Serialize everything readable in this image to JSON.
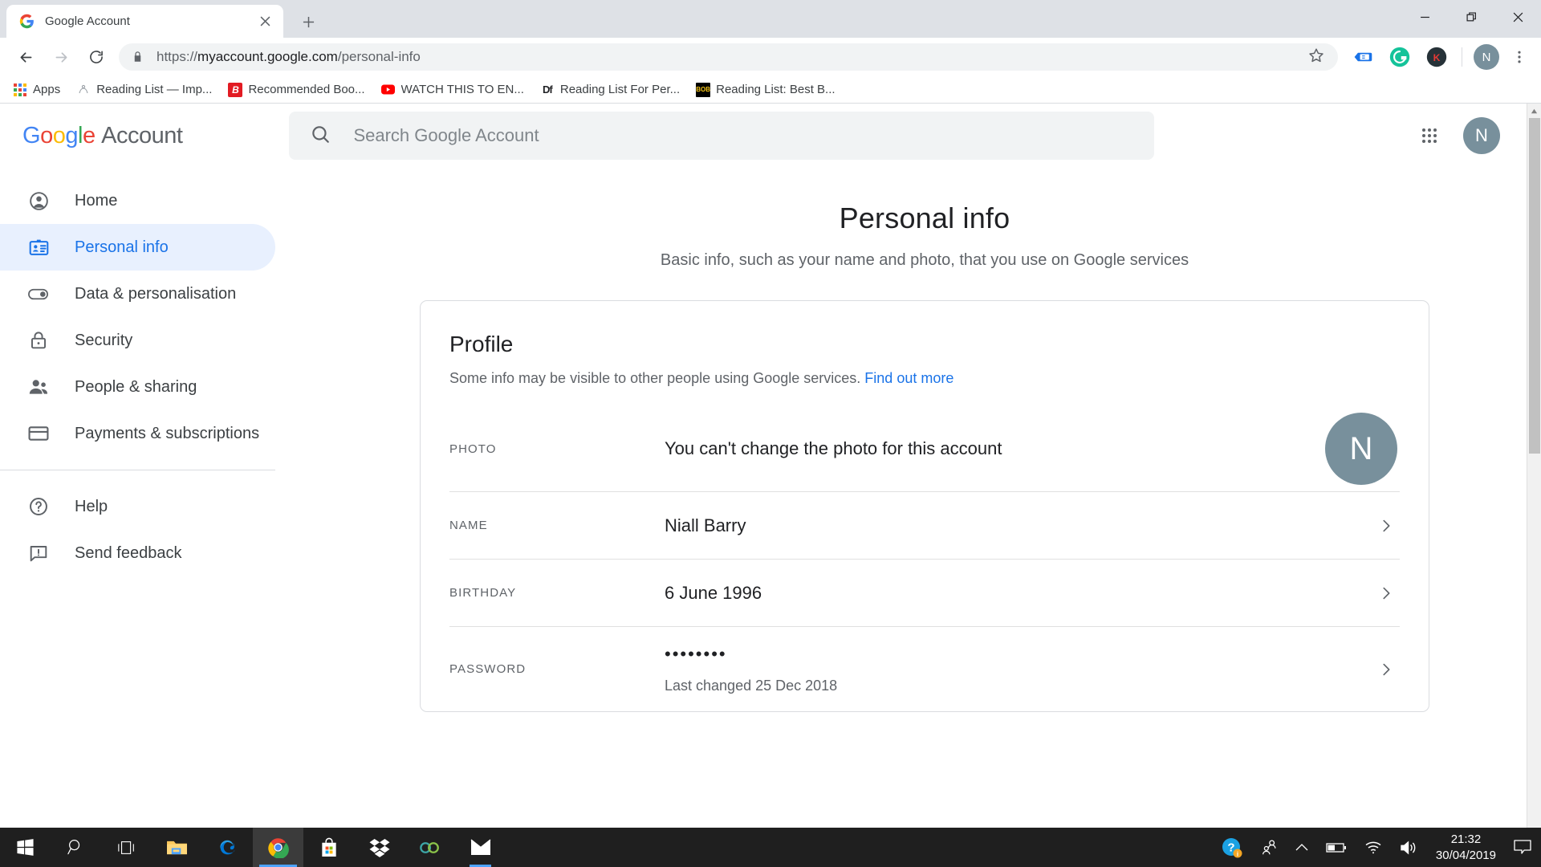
{
  "browser": {
    "tab": {
      "title": "Google Account",
      "favicon": "google-g-icon"
    },
    "new_tab_label": "+",
    "window_controls": {
      "minimize": "minimize-icon",
      "restore": "restore-icon",
      "close": "close-icon"
    },
    "nav": {
      "back": "back-arrow-icon",
      "forward": "forward-arrow-icon",
      "reload": "reload-icon"
    },
    "omnibox": {
      "lock": "lock-icon",
      "scheme": "https://",
      "host": "myaccount.google.com",
      "path": "/personal-info",
      "full_url": "https://myaccount.google.com/personal-info",
      "star": "star-icon"
    },
    "extensions": [
      {
        "name": "pocket-tag-icon",
        "letter": "",
        "bg": "#1a73e8"
      },
      {
        "name": "grammarly-icon",
        "letter": "G",
        "bg": "#15c39a"
      },
      {
        "name": "kami-icon",
        "letter": "K",
        "bg": "#263238"
      }
    ],
    "profile_initial": "N",
    "menu": "kebab-menu-icon",
    "bookmarks": [
      {
        "label": "Apps",
        "icon": "apps-grid-icon"
      },
      {
        "label": "Reading List — Imp...",
        "icon": "generic-site-icon"
      },
      {
        "label": "Recommended Boo...",
        "icon": "blinkist-icon"
      },
      {
        "label": "WATCH THIS TO EN...",
        "icon": "youtube-icon"
      },
      {
        "label": "Reading List For Per...",
        "icon": "df-icon"
      },
      {
        "label": "Reading List: Best B...",
        "icon": "bob-icon"
      }
    ]
  },
  "gaccount": {
    "logo": {
      "g1": "G",
      "o1": "o",
      "o2": "o",
      "g2": "g",
      "l": "l",
      "e": "e",
      "product": "Account"
    },
    "search_placeholder": "Search Google Account",
    "apps_grid": "apps-grid-icon",
    "avatar_initial": "N"
  },
  "sidebar": {
    "items": [
      {
        "label": "Home",
        "icon": "account-circle-icon",
        "active": false
      },
      {
        "label": "Personal info",
        "icon": "contact-card-icon",
        "active": true
      },
      {
        "label": "Data & personalisation",
        "icon": "toggle-switch-icon",
        "active": false
      },
      {
        "label": "Security",
        "icon": "lock-icon",
        "active": false
      },
      {
        "label": "People & sharing",
        "icon": "people-icon",
        "active": false
      },
      {
        "label": "Payments & subscriptions",
        "icon": "credit-card-icon",
        "active": false
      }
    ],
    "secondary": [
      {
        "label": "Help",
        "icon": "help-circle-icon"
      },
      {
        "label": "Send feedback",
        "icon": "feedback-icon"
      }
    ]
  },
  "main": {
    "title": "Personal info",
    "subtitle": "Basic info, such as your name and photo, that you use on Google services",
    "card": {
      "title": "Profile",
      "description": "Some info may be visible to other people using Google services.",
      "link": "Find out more",
      "rows": [
        {
          "label": "PHOTO",
          "value": "You can't change the photo for this account",
          "sub": "",
          "avatar": "N",
          "chevron": false
        },
        {
          "label": "NAME",
          "value": "Niall Barry",
          "sub": "",
          "chevron": true
        },
        {
          "label": "BIRTHDAY",
          "value": "6 June 1996",
          "sub": "",
          "chevron": true
        },
        {
          "label": "PASSWORD",
          "value": "••••••••",
          "sub": "Last changed 25 Dec 2018",
          "chevron": true
        }
      ]
    }
  },
  "taskbar": {
    "items": [
      {
        "name": "start-button",
        "icon": "windows-logo-icon"
      },
      {
        "name": "search-button",
        "icon": "search-icon"
      },
      {
        "name": "task-view-button",
        "icon": "task-view-icon"
      },
      {
        "name": "file-explorer-button",
        "icon": "folder-icon"
      },
      {
        "name": "edge-button",
        "icon": "edge-icon"
      },
      {
        "name": "chrome-button",
        "icon": "chrome-icon"
      },
      {
        "name": "microsoft-store-button",
        "icon": "store-bag-icon"
      },
      {
        "name": "dropbox-button",
        "icon": "dropbox-icon"
      },
      {
        "name": "infinity-app-button",
        "icon": "infinity-icon"
      },
      {
        "name": "mail-button",
        "icon": "mail-envelope-icon"
      }
    ],
    "tray": {
      "help": "help-question-icon",
      "people": "people-icon",
      "chevron": "chevron-up-icon",
      "battery": "battery-icon",
      "wifi": "wifi-icon",
      "volume": "volume-icon",
      "time": "21:32",
      "date": "30/04/2019",
      "notifications": "notification-icon"
    }
  },
  "colors": {
    "google_blue": "#1a73e8",
    "active_nav_bg": "#e8f0fe",
    "avatar_bg": "#78909c",
    "taskbar_bg": "#1f1f1f"
  }
}
